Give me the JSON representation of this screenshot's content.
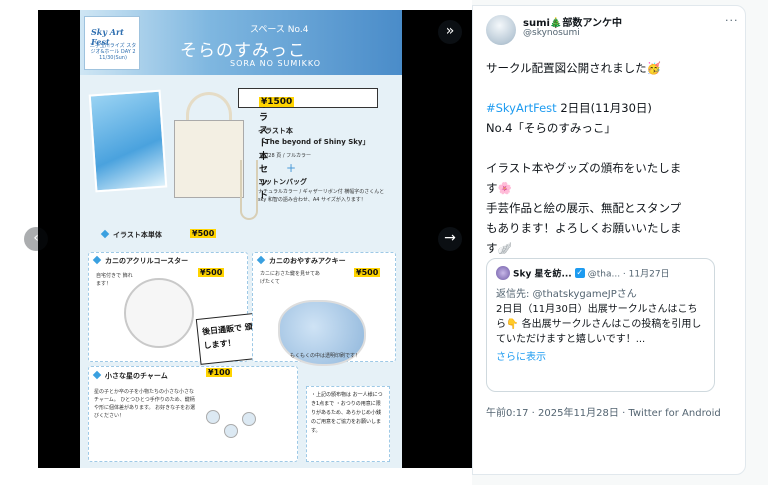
{
  "flyer": {
    "brand": "Sky Art Fest",
    "brand_sub": "二子玉川ライズ スタジオ&ホール DAY 2 11/30(Sun)",
    "space_no": "スペース No.4",
    "title_jp": "そらのすみっこ",
    "title_en": "SORA NO SUMIKKO",
    "set_label": "イラスト本セット",
    "set_price": "¥1500",
    "book_label": "イラスト本",
    "book_title": "「The beyond of Shiny Sky」",
    "book_spec": "B5/28 頁 / フルカラー",
    "plus": "+",
    "bag_label": "コットンバッグ",
    "bag_desc": "ナチュラルカラー / ギャザーリボン付 横幅字のさくんと sky 和智の語み合わせ、A4 サイズが入ります！",
    "single_label": "イラスト本単体",
    "single_price": "¥500",
    "coaster_label": "カニのアクリルコースター",
    "coaster_price": "¥500",
    "coaster_note": "自宅付きで 飾れます！",
    "sticker_text": "後日通販で 頒布します！",
    "acrylic_label": "カニのおやすみアクキー",
    "acrylic_price": "¥500",
    "acrylic_note": "カニにおさた鍵を見せてあげたくて",
    "acrylic_caption": "もくもくの中は透明印刷です！",
    "charm_label": "小さな星のチャーム",
    "charm_price": "¥100",
    "charm_note": "星の子とか卒の子を小物たちの小さな小さなチャーム。 ひとつひとつ手作りのため、鍵柄や形に個体差があります。 お好きな子をお選びください！",
    "notes": "・上記の頒布物は お一人様につき1点まで ・おつりの用意に限りがあるため、あらかじめ小銭のご用意をご協力をお願いします。"
  },
  "nav": {
    "expand_icon": "»",
    "prev_icon": "‹",
    "next_icon": "→"
  },
  "tweet": {
    "name": "sumi🎄部数アンケ中",
    "handle": "@skynosumi",
    "more": "···",
    "lines": {
      "l1": "サークル配置図公開されました🥳",
      "l2": "",
      "hashtag": "#SkyArtFest",
      "l3_rest": " 2日目(11月30日)",
      "l4": "No.4「そらのすみっこ」",
      "l5": "",
      "l6": "イラスト本やグッズの頒布をいたしま",
      "l7": "す🌸",
      "l8": "手芸作品と絵の展示、無配とスタンプ",
      "l9": "もあります！よろしくお願いいたしま",
      "l10": "す🪽"
    },
    "quote": {
      "name": "Sky 星を紡...",
      "verified": "✓",
      "handle": "@tha... · 11月27日",
      "reply_to": "返信先: @thatskygameJPさん",
      "body": "2日目（11月30日）出展サークルさんはこちら👇 各出展サークルさんはこの投稿を引用していただけますと嬉しいです！...",
      "show_more": "さらに表示"
    },
    "timestamp": "午前0:17 · 2025年11月28日 · Twitter for Android"
  }
}
